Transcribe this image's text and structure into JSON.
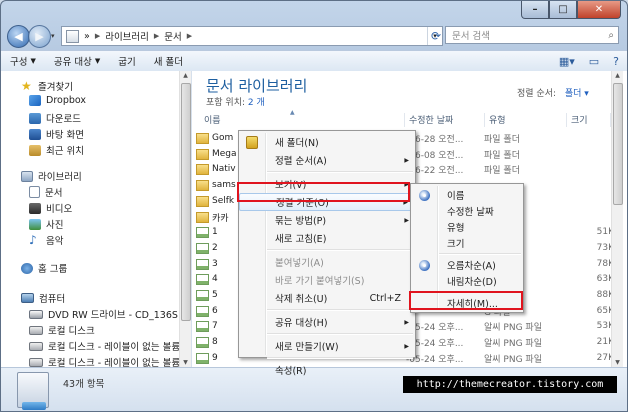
{
  "window": {
    "controls": {
      "minimize": "–",
      "maximize": "□",
      "close": "✕"
    }
  },
  "address": {
    "back": "◀",
    "forward": "▶",
    "crumbs": [
      "»",
      "라이브러리",
      "문서"
    ],
    "search_placeholder": "문서 검색"
  },
  "toolbar": {
    "items": [
      {
        "label": "구성",
        "has_caret": true
      },
      {
        "label": "공유 대상",
        "has_caret": true
      },
      {
        "label": "굽기",
        "has_caret": false
      },
      {
        "label": "새 폴더",
        "has_caret": false
      }
    ]
  },
  "sidebar": {
    "favorites": "즐겨찾기",
    "fav_items": [
      "Dropbox",
      "다운로드",
      "바탕 화면",
      "최근 위치"
    ],
    "libraries": "라이브러리",
    "lib_items": [
      "문서",
      "비디오",
      "사진",
      "음악"
    ],
    "homegroup": "홈 그룹",
    "computer": "컴퓨터",
    "computer_items": [
      "DVD RW 드라이브 - CD_136S",
      "로컬 디스크",
      "로컬 디스크 - 레이블이 없는 볼륨",
      "로컬 디스크 - 레이블이 없는 볼륨"
    ]
  },
  "content": {
    "title": "문서 라이브러리",
    "includes_label": "포함 위치:",
    "includes_value": "2 개",
    "arrange_label": "정렬 순서:",
    "arrange_value": "폴더 ▾",
    "columns": [
      "이름",
      "수정한 날짜",
      "유형",
      "크기"
    ],
    "rows": [
      {
        "name": "Gom",
        "date": "-06-28 오전...",
        "type": "파일 폴더",
        "size": "",
        "icon": "folder"
      },
      {
        "name": "Mega",
        "date": "-06-08 오전...",
        "type": "파일 폴더",
        "size": "",
        "icon": "folder"
      },
      {
        "name": "Nativ",
        "date": "-06-22 오전...",
        "type": "파일 폴더",
        "size": "",
        "icon": "folder"
      },
      {
        "name": "sams",
        "date": "",
        "type": "",
        "size": "",
        "icon": "folder"
      },
      {
        "name": "Selfk",
        "date": "",
        "type": "",
        "size": "",
        "icon": "folder"
      },
      {
        "name": "카카",
        "date": "",
        "type": "",
        "size": "",
        "icon": "folder"
      },
      {
        "name": "1",
        "date": "",
        "type": "G 파일",
        "size": "51K",
        "icon": "png"
      },
      {
        "name": "2",
        "date": "",
        "type": "G 파일",
        "size": "73K",
        "icon": "png"
      },
      {
        "name": "3",
        "date": "",
        "type": "G 파일",
        "size": "78K",
        "icon": "png"
      },
      {
        "name": "4",
        "date": "",
        "type": "G 파일",
        "size": "63K",
        "icon": "png"
      },
      {
        "name": "5",
        "date": "",
        "type": "G 파일",
        "size": "88K",
        "icon": "png"
      },
      {
        "name": "6",
        "date": "",
        "type": "G 파일",
        "size": "65K",
        "icon": "png"
      },
      {
        "name": "7",
        "date": "-05-24 오후...",
        "type": "알씨 PNG 파일",
        "size": "53K",
        "icon": "png"
      },
      {
        "name": "8",
        "date": "-05-24 오후...",
        "type": "알씨 PNG 파일",
        "size": "21K",
        "icon": "png"
      },
      {
        "name": "9",
        "date": "-05-24 오후...",
        "type": "알씨 PNG 파일",
        "size": "27K",
        "icon": "png"
      }
    ]
  },
  "context_menu": {
    "items": [
      {
        "label": "새 폴더(N)",
        "icon": "lock"
      },
      {
        "label": "정렬 순서(A)",
        "submenu": true
      },
      {
        "sep": true
      },
      {
        "label": "보기(V)",
        "submenu": true
      },
      {
        "label": "정렬 기준(O)",
        "submenu": true,
        "highlight": true
      },
      {
        "label": "묶는 방법(P)",
        "submenu": true
      },
      {
        "label": "새로 고침(E)"
      },
      {
        "sep": true
      },
      {
        "label": "붙여넣기(A)",
        "disabled": true
      },
      {
        "label": "바로 가기 붙여넣기(S)",
        "disabled": true
      },
      {
        "label": "삭제 취소(U)",
        "shortcut": "Ctrl+Z"
      },
      {
        "sep": true
      },
      {
        "label": "공유 대상(H)",
        "submenu": true
      },
      {
        "sep": true
      },
      {
        "label": "새로 만들기(W)",
        "submenu": true
      },
      {
        "sep": true
      },
      {
        "label": "속성(R)"
      }
    ]
  },
  "submenu": {
    "items": [
      {
        "label": "이름",
        "radio": true
      },
      {
        "label": "수정한 날짜"
      },
      {
        "label": "유형"
      },
      {
        "label": "크기"
      },
      {
        "sep": true
      },
      {
        "label": "오름차순(A)",
        "radio": true
      },
      {
        "label": "내림차순(D)"
      },
      {
        "sep": true
      },
      {
        "label": "자세히(M)..."
      }
    ]
  },
  "status": {
    "count": "43개 항목"
  },
  "watermark": "http://themecreator.tistory.com",
  "colors": {
    "highlight_box": "#e0141e",
    "title_blue": "#1e5fa0",
    "link_blue": "#1f5fbf"
  }
}
